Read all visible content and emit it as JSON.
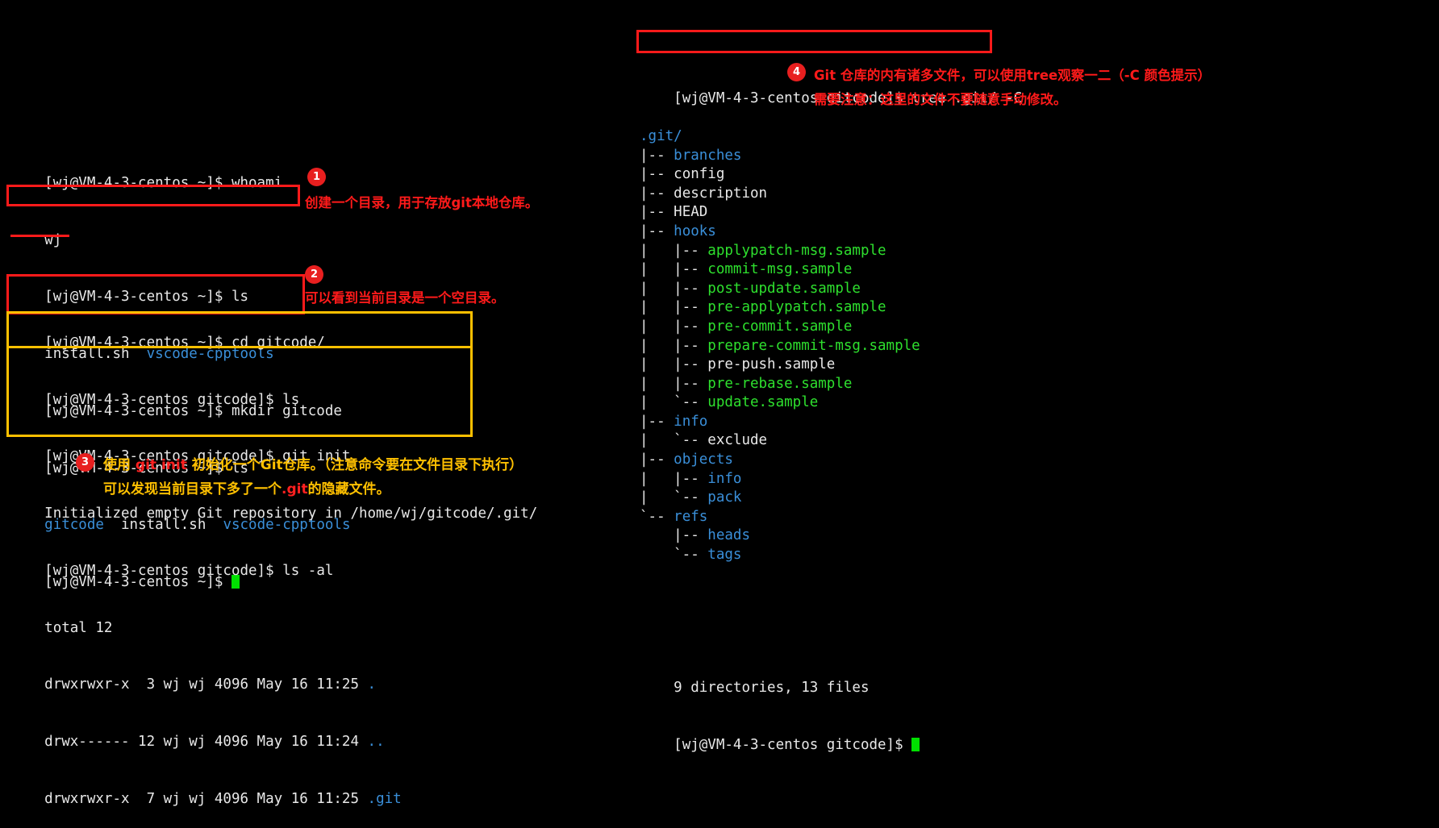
{
  "terminal": {
    "prompt_home": "[wj@VM-4-3-centos ~]$ ",
    "prompt_gitcode": "[wj@VM-4-3-centos gitcode]$ ",
    "left_block_1": [
      {
        "prompt": "[wj@VM-4-3-centos ~]$ ",
        "cmd": "whoami"
      },
      {
        "output": "wj"
      },
      {
        "prompt": "[wj@VM-4-3-centos ~]$ ",
        "cmd": "ls"
      },
      {
        "output_plain": "install.sh  ",
        "output_dir": "vscode-cpptools"
      },
      {
        "prompt": "[wj@VM-4-3-centos ~]$ ",
        "cmd": "mkdir gitcode"
      },
      {
        "prompt": "[wj@VM-4-3-centos ~]$ ",
        "cmd": "ls"
      },
      {
        "output_dir2": "gitcode",
        "output_plain2": "  install.sh  ",
        "output_dir3": "vscode-cpptools"
      },
      {
        "prompt": "[wj@VM-4-3-centos ~]$ ",
        "cmd": "",
        "cursor": true
      }
    ],
    "left_block_2": [
      {
        "prompt": "[wj@VM-4-3-centos ~]$ ",
        "cmd": "cd gitcode/"
      },
      {
        "prompt": "[wj@VM-4-3-centos gitcode]$ ",
        "cmd": "ls"
      },
      {
        "prompt": "[wj@VM-4-3-centos gitcode]$ ",
        "cmd": "git init"
      },
      {
        "output": "Initialized empty Git repository in /home/wj/gitcode/.git/"
      },
      {
        "prompt": "[wj@VM-4-3-centos gitcode]$ ",
        "cmd": "ls -al"
      },
      {
        "output": "total 12"
      },
      {
        "output_ls": "drwxrwxr-x  3 wj wj 4096 May 16 11:25 ",
        "entry": ".",
        "entry_color": "blue"
      },
      {
        "output_ls": "drwx------ 12 wj wj 4096 May 16 11:24 ",
        "entry": "..",
        "entry_color": "blue"
      },
      {
        "output_ls": "drwxrwxr-x  7 wj wj 4096 May 16 11:25 ",
        "entry": ".git",
        "entry_color": "blue"
      }
    ],
    "right_block": {
      "prompt": "[wj@VM-4-3-centos gitcode]$ ",
      "cmd": "tree .git/ -C",
      "tree": [
        {
          "indent": "",
          "name": ".git/",
          "type": "dir"
        },
        {
          "indent": "|-- ",
          "name": "branches",
          "type": "dir"
        },
        {
          "indent": "|-- ",
          "name": "config",
          "type": "file"
        },
        {
          "indent": "|-- ",
          "name": "description",
          "type": "file"
        },
        {
          "indent": "|-- ",
          "name": "HEAD",
          "type": "file"
        },
        {
          "indent": "|-- ",
          "name": "hooks",
          "type": "dir"
        },
        {
          "indent": "|   |-- ",
          "name": "applypatch-msg.sample",
          "type": "exec"
        },
        {
          "indent": "|   |-- ",
          "name": "commit-msg.sample",
          "type": "exec"
        },
        {
          "indent": "|   |-- ",
          "name": "post-update.sample",
          "type": "exec"
        },
        {
          "indent": "|   |-- ",
          "name": "pre-applypatch.sample",
          "type": "exec"
        },
        {
          "indent": "|   |-- ",
          "name": "pre-commit.sample",
          "type": "exec"
        },
        {
          "indent": "|   |-- ",
          "name": "prepare-commit-msg.sample",
          "type": "exec"
        },
        {
          "indent": "|   |-- ",
          "name": "pre-push.sample",
          "type": "file"
        },
        {
          "indent": "|   |-- ",
          "name": "pre-rebase.sample",
          "type": "exec"
        },
        {
          "indent": "|   `-- ",
          "name": "update.sample",
          "type": "exec"
        },
        {
          "indent": "|-- ",
          "name": "info",
          "type": "dir"
        },
        {
          "indent": "|   `-- ",
          "name": "exclude",
          "type": "file"
        },
        {
          "indent": "|-- ",
          "name": "objects",
          "type": "dir"
        },
        {
          "indent": "|   |-- ",
          "name": "info",
          "type": "dir"
        },
        {
          "indent": "|   `-- ",
          "name": "pack",
          "type": "dir"
        },
        {
          "indent": "`-- ",
          "name": "refs",
          "type": "dir"
        },
        {
          "indent": "    |-- ",
          "name": "heads",
          "type": "dir"
        },
        {
          "indent": "    `-- ",
          "name": "tags",
          "type": "dir"
        }
      ],
      "summary": "9 directories, 13 files",
      "final_prompt": "[wj@VM-4-3-centos gitcode]$ "
    }
  },
  "annotations": {
    "badge1": "1",
    "note1": "创建一个目录，用于存放git本地仓库。",
    "badge2": "2",
    "note2": "可以看到当前目录是一个空目录。",
    "badge3": "3",
    "note3_part1": "使用 ",
    "note3_cmd": "git init",
    "note3_part2": " 初始化一个Git仓库。（注意命令要在文件目录下执行）",
    "note3_line2_part1": "可以发现当前目录下多了一个",
    "note3_line2_cmd": ".git",
    "note3_line2_part2": "的隐藏文件。",
    "badge4": "4",
    "note4_line1": "Git 仓库的内有诸多文件，可以使用tree观察一二（-C 颜色提示）",
    "note4_line2": "需要注意：这里的文件不要随意手动修改。"
  },
  "colors": {
    "red": "#ff1a1a",
    "yellow": "#ffc000",
    "blue": "#3a8fd9",
    "green": "#2ee02e",
    "cursor_green": "#00e000",
    "terminal_bg": "#000000",
    "terminal_fg": "#e6e6e6"
  }
}
